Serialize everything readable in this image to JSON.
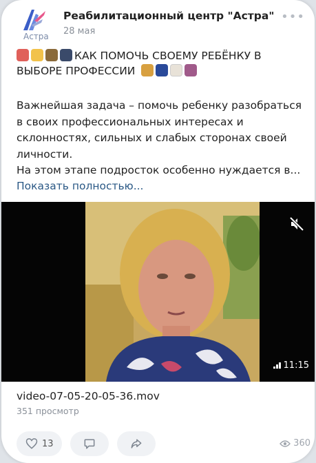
{
  "post": {
    "author": "Реабилитационный центр \"Астра\"",
    "logo_text": "Астра",
    "date": "28 мая",
    "title_line1": "КАК ПОМОЧЬ СВОЕМУ РЕБЁНКУ В",
    "title_line2": "ВЫБОРЕ ПРОФЕССИИ",
    "text_lines": [
      "Важнейшая задача – помочь ребенку разобраться",
      "в своих профессиональных интересах и",
      "склонностях, сильных и слабых сторонах своей",
      "личности.",
      "На этом этапе подросток особенно нуждается в..."
    ],
    "show_more": "Показать полностью..."
  },
  "video": {
    "duration": "11:15",
    "filename": "video-07-05-20-05-36.mov",
    "views": "351 просмотр"
  },
  "actions": {
    "likes": "13",
    "views_short": "360"
  },
  "icons": {
    "more": "more-dots-icon",
    "mute": "muted-speaker-icon",
    "like": "heart-icon",
    "comment": "comment-icon",
    "share": "share-arrow-icon",
    "views": "eye-icon"
  },
  "colors": {
    "link": "#2a5885",
    "logo_blue": "#3b5ec8",
    "logo_pink": "#e8588c"
  }
}
